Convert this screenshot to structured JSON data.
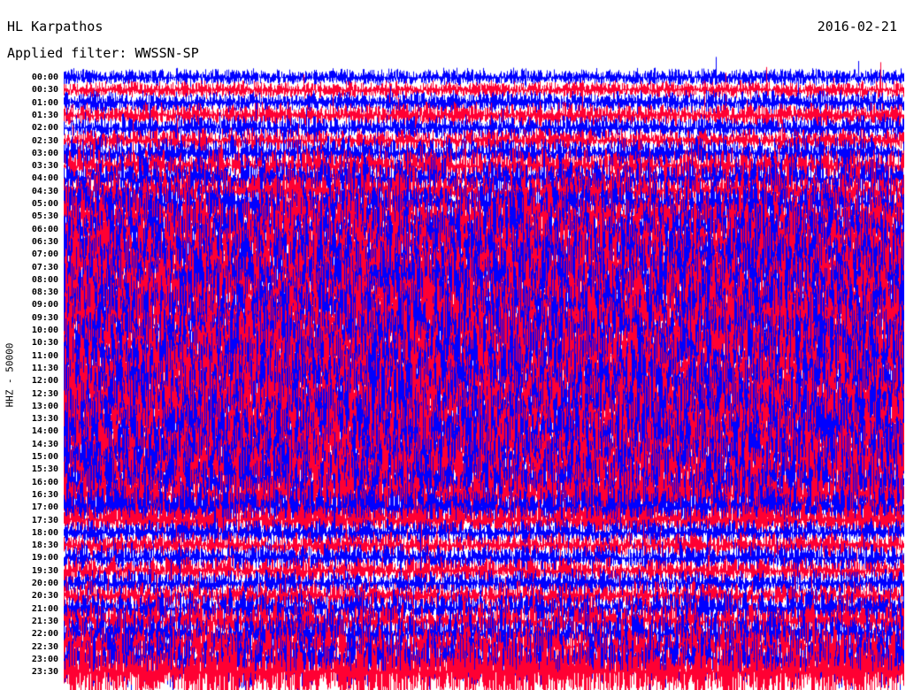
{
  "header": {
    "station": "HL Karpathos",
    "date": "2016-02-21",
    "filter": "Applied filter: WWSSN-SP"
  },
  "chart_data": {
    "type": "helicorder",
    "title": "HL Karpathos",
    "date": "2016-02-21",
    "filter_label": "Applied filter: WWSSN-SP",
    "ylabel": "HHZ - 50000",
    "ticks": [
      "00:00",
      "00:30",
      "01:00",
      "01:30",
      "02:00",
      "02:30",
      "03:00",
      "03:30",
      "04:00",
      "04:30",
      "05:00",
      "05:30",
      "06:00",
      "06:30",
      "07:00",
      "07:30",
      "08:00",
      "08:30",
      "09:00",
      "09:30",
      "10:00",
      "10:30",
      "11:00",
      "11:30",
      "12:00",
      "12:30",
      "13:00",
      "13:30",
      "14:00",
      "14:30",
      "15:00",
      "15:30",
      "16:00",
      "16:30",
      "17:00",
      "17:30",
      "18:00",
      "18:30",
      "19:00",
      "19:30",
      "20:00",
      "20:30",
      "21:00",
      "21:30",
      "22:00",
      "22:30",
      "23:00",
      "23:30"
    ],
    "trace_colors": [
      "#0000ff",
      "#ff0033"
    ],
    "rows": 48,
    "row_minutes": 30,
    "relative_noise_level": [
      0.15,
      0.16,
      0.22,
      0.25,
      0.26,
      0.24,
      0.35,
      0.42,
      0.5,
      0.55,
      0.62,
      0.7,
      0.78,
      0.86,
      0.92,
      0.96,
      1.0,
      1.0,
      1.0,
      1.0,
      1.0,
      1.0,
      1.0,
      1.0,
      1.0,
      1.0,
      1.0,
      1.0,
      1.0,
      1.0,
      1.0,
      0.98,
      0.92,
      0.82,
      0.62,
      0.42,
      0.3,
      0.26,
      0.32,
      0.3,
      0.28,
      0.3,
      0.42,
      0.5,
      0.55,
      0.6,
      0.78,
      0.95
    ]
  }
}
